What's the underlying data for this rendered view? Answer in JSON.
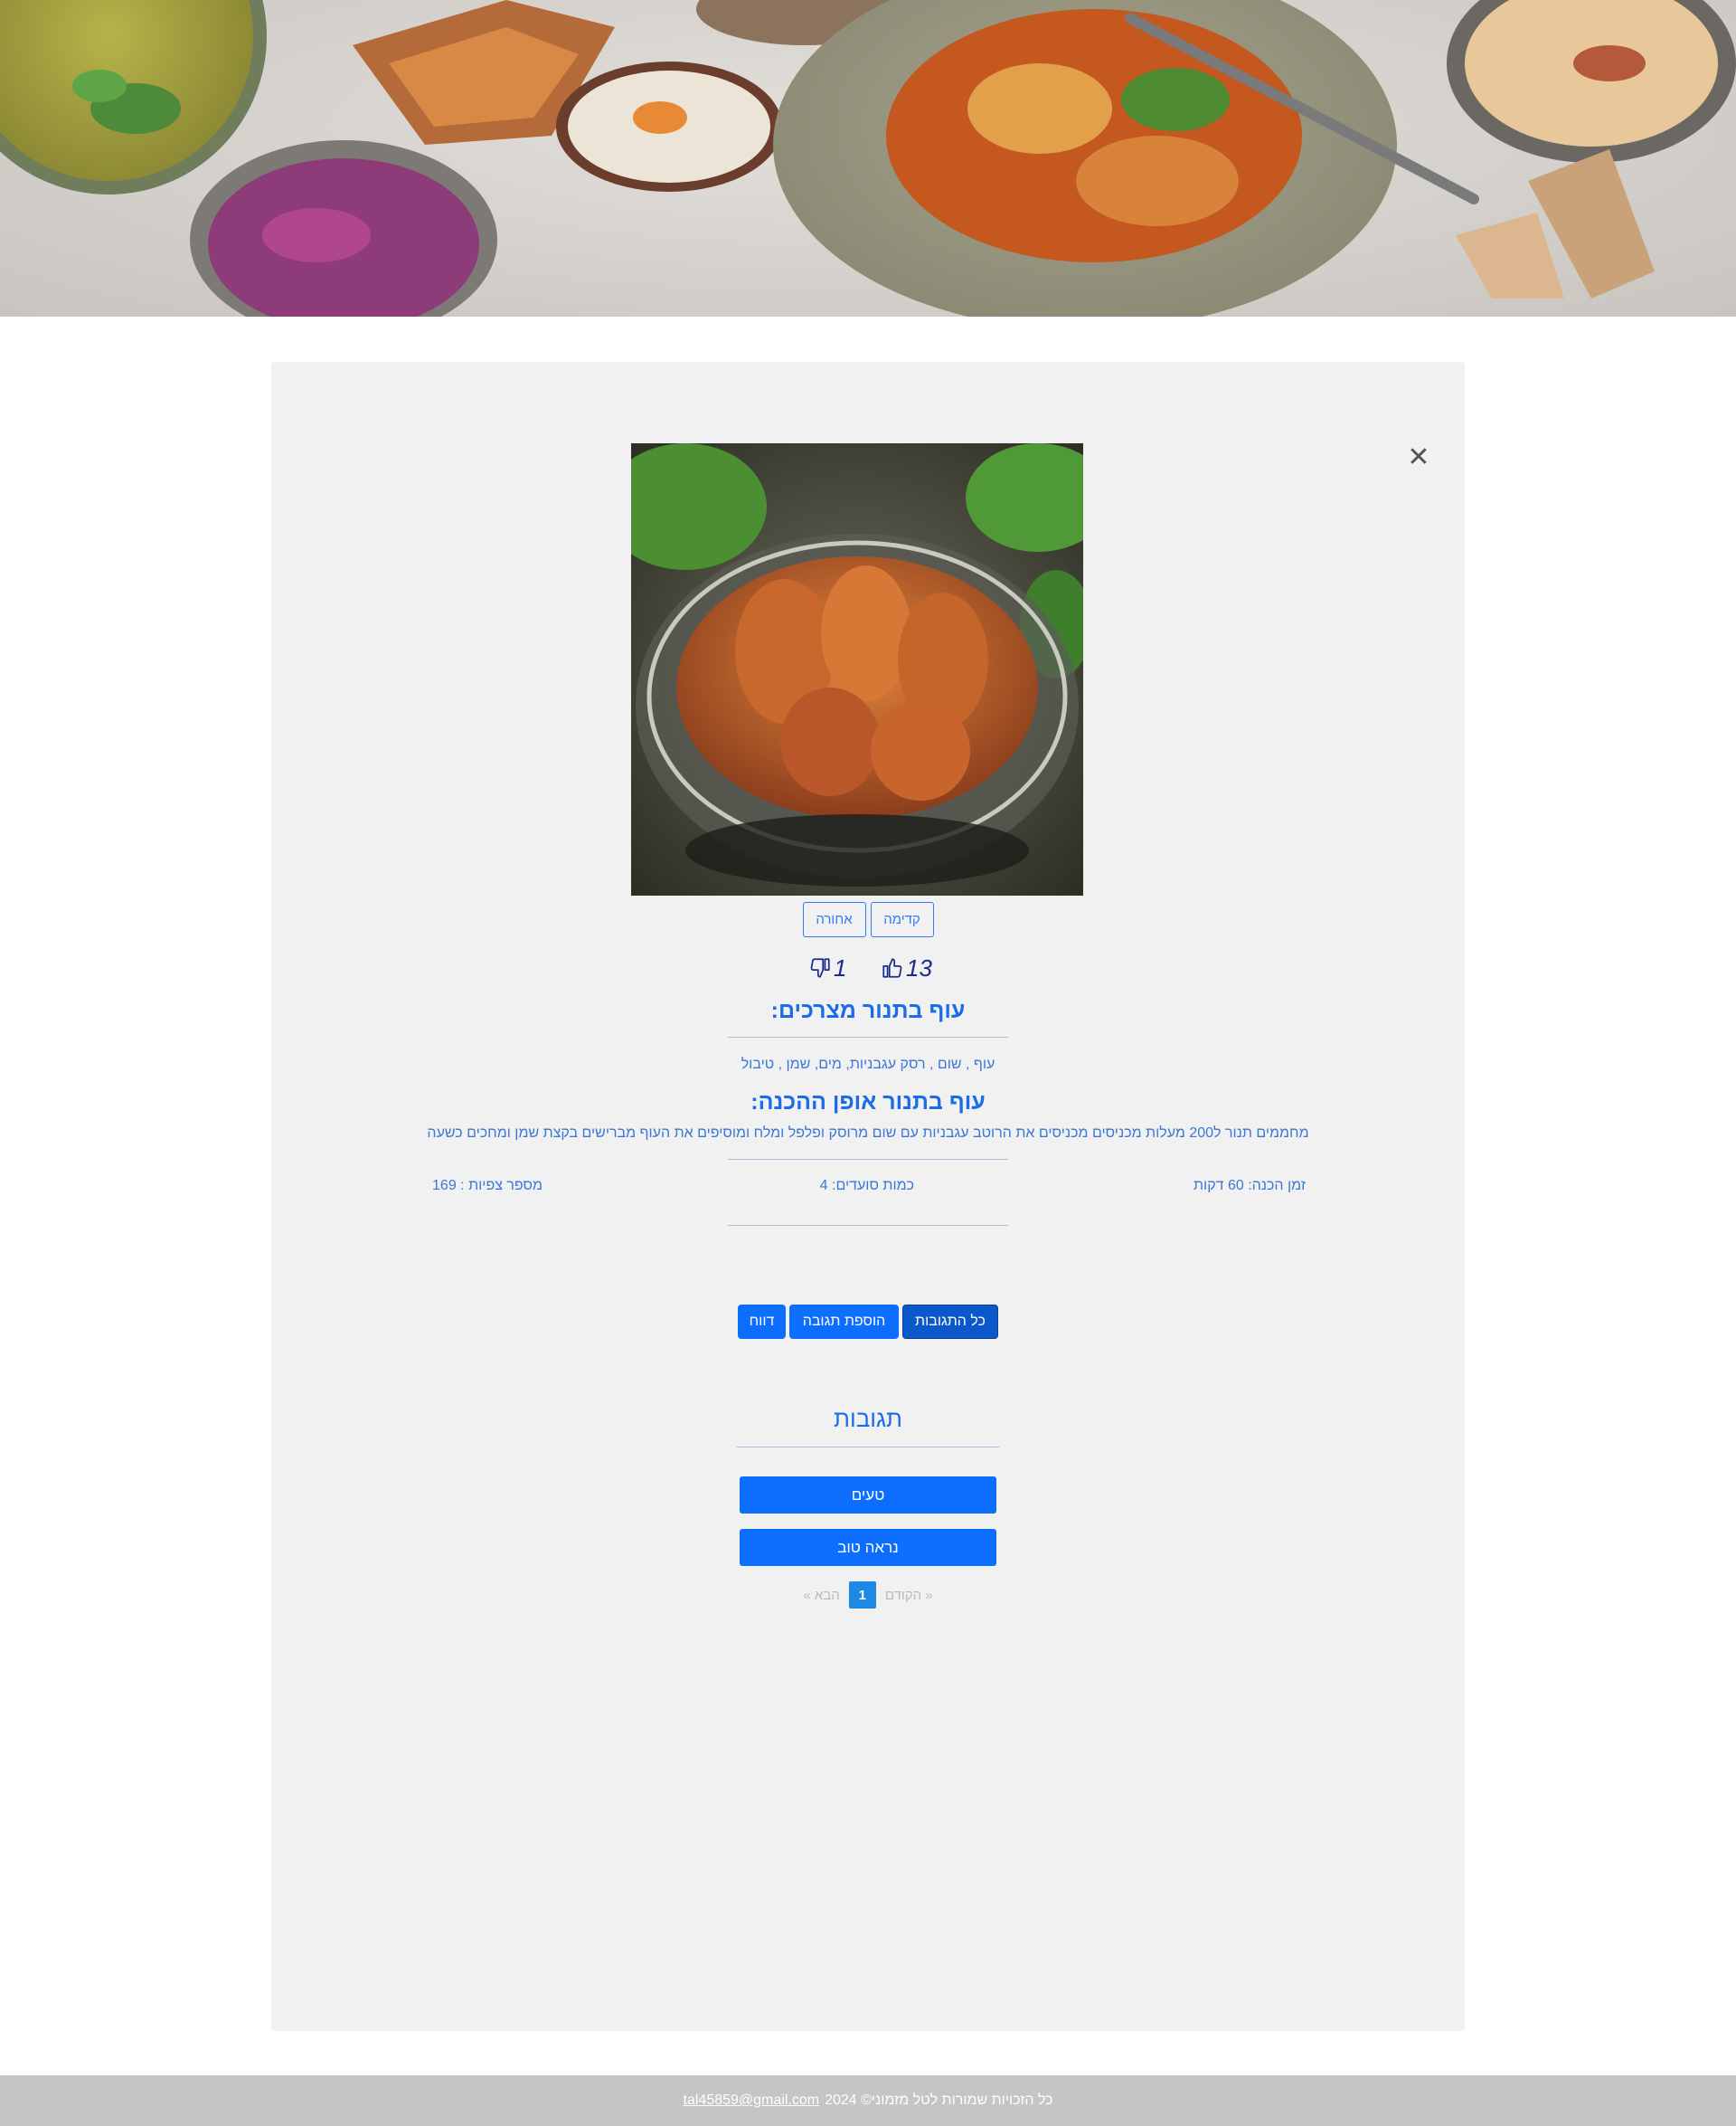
{
  "hero": {
    "image": "food-spread-banner"
  },
  "recipe": {
    "image": "oven-baked-chicken-in-glass-bowl",
    "nav": {
      "previous_label": "קדימה",
      "next_label": "אחורה"
    },
    "likes": "13",
    "dislikes": "1",
    "ingredients_title": "עוף בתנור מצרכים:",
    "ingredients_text": "עוף , שום , רסק עגבניות, מים, שמן , טיבול",
    "method_title": "עוף בתנור אופן ההכנה:",
    "method_text": "מחממים תנור ל200 מעלות מכניסים מכניסים את הרוטב עגבניות עם שום מרוסק ופלפל ומלח ומוסיפים את העוף מברישים בקצת שמן ומחכים כשעה",
    "prep_time": "זמן הכנה: 60 דקות",
    "servings": "כמות סועדים: 4",
    "views": "מספר צפיות : 169"
  },
  "actions": {
    "all_comments_label": "כל התגובות",
    "add_comment_label": "הוספת תגובה",
    "report_label": "דווח"
  },
  "comments": {
    "title": "תגובות",
    "items": [
      "טעים",
      "נראה טוב"
    ]
  },
  "pagination": {
    "prev_label": "« הקודם",
    "current_page": "1",
    "next_label": "הבא »"
  },
  "footer": {
    "copyright": "כל הזכויות שמורות לטל מזמוני© 2024",
    "email": "tal45859@gmail.com"
  },
  "colors": {
    "accent": "#0d6efd",
    "heading": "#1a6ce8",
    "card_background": "#f1f1f1",
    "footer_background": "#c4c5c7"
  },
  "icons": {
    "close": "close-icon",
    "like": "thumbs-up-icon",
    "dislike": "thumbs-down-icon"
  }
}
